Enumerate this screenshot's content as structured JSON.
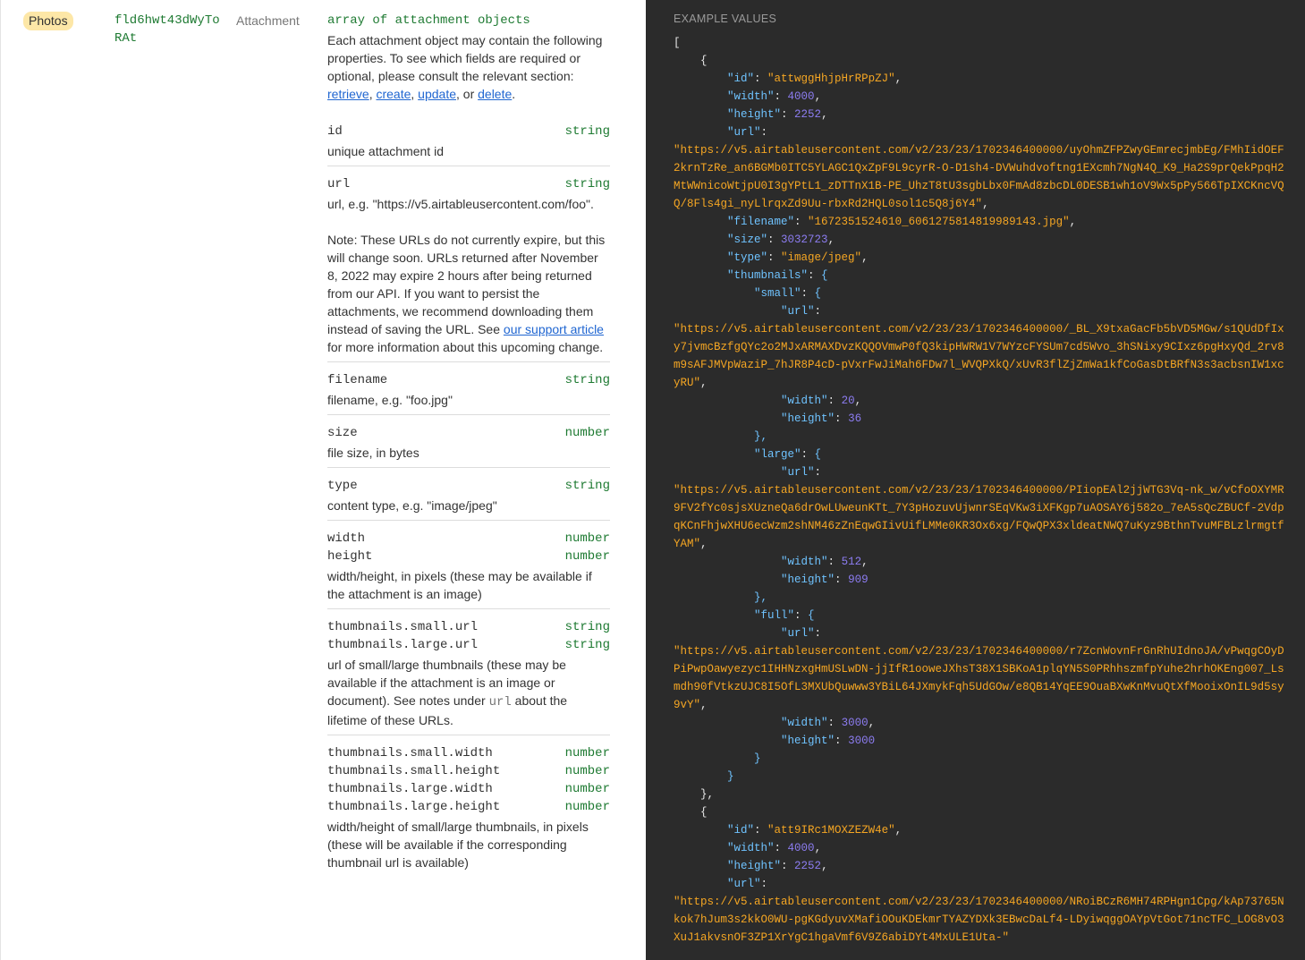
{
  "field": {
    "name": "Photos",
    "id": "fld6hwt43dWyToRAt",
    "type": "Attachment"
  },
  "description": {
    "type_label": "array of attachment objects",
    "intro_1": "Each attachment object may contain the following properties. To see which fields are required or optional, please consult the relevant section: ",
    "link_retrieve": "retrieve",
    "link_create": "create",
    "link_update": "update",
    "link_delete": "delete",
    "sep_1": ", ",
    "sep_2": ", ",
    "sep_3": ", or ",
    "end": ".",
    "properties": [
      {
        "name": "id",
        "kind": "string",
        "desc": "unique attachment id"
      },
      {
        "name": "url",
        "kind": "string",
        "desc": "url, e.g. \"https://v5.airtableusercontent.com/foo\"."
      },
      {
        "name": "filename",
        "kind": "string",
        "desc": "filename, e.g. \"foo.jpg\""
      },
      {
        "name": "size",
        "kind": "number",
        "desc": "file size, in bytes"
      },
      {
        "name": "type",
        "kind": "string",
        "desc": "content type, e.g. \"image/jpeg\""
      },
      {
        "name": "width",
        "kind": "number"
      },
      {
        "name": "height",
        "kind": "number",
        "desc": "width/height, in pixels (these may be available if the attachment is an image)"
      },
      {
        "name": "thumbnails.small.url",
        "kind": "string"
      },
      {
        "name": "thumbnails.large.url",
        "kind": "string",
        "desc_a": "url of small/large thumbnails (these may be available if the attachment is an image or document). See notes under ",
        "desc_code": "url",
        "desc_b": " about the lifetime of these URLs."
      },
      {
        "name": "thumbnails.small.width",
        "kind": "number"
      },
      {
        "name": "thumbnails.small.height",
        "kind": "number"
      },
      {
        "name": "thumbnails.large.width",
        "kind": "number"
      },
      {
        "name": "thumbnails.large.height",
        "kind": "number",
        "desc": "width/height of small/large thumbnails, in pixels (these will be available if the corresponding thumbnail url is available)"
      }
    ],
    "url_note_1": "Note: These URLs do not currently expire, but this will change soon. URLs returned after November 8, 2022 may expire 2 hours after being returned from our API. If you want to persist the attachments, we recommend downloading them instead of saving the URL. See ",
    "url_note_link": "our support article",
    "url_note_2": " for more information about this upcoming change."
  },
  "example": {
    "label": "EXAMPLE VALUES",
    "att1": {
      "id": "\"attwggHhjpHrRPpZJ\"",
      "width": "4000",
      "height": "2252",
      "url": "\"https://v5.airtableusercontent.com/v2/23/23/1702346400000/uyOhmZFPZwyGEmrecjmbEg/FMhIidOEF2krnTzRe_an6BGMb0ITC5YLAGC1QxZpF9L9cyrR-O-D1sh4-DVWuhdvoftng1EXcmh7NgN4Q_K9_Ha2S9prQekPpqH2MtWWnicoWtjpU0I3gYPtL1_zDTTnX1B-PE_UhzT8tU3sgbLbx0FmAd8zbcDL0DESB1wh1oV9Wx5pPy566TpIXCKncVQQ/8Fls4gi_nyLlrqxZd9Uu-rbxRd2HQL0sol1c5Q8j6Y4\"",
      "filename": "\"1672351524610_6061275814819989143.jpg\"",
      "size": "3032723",
      "type": "\"image/jpeg\"",
      "small_url": "\"https://v5.airtableusercontent.com/v2/23/23/1702346400000/_BL_X9txaGacFb5bVD5MGw/s1QUdDfIxy7jvmcBzfgQYc2o2MJxARMAXDvzKQQOVmwP0fQ3kipHWRW1V7WYzcFYSUm7cd5Wvo_3hSNixy9CIxz6pgHxyQd_2rv8m9sAFJMVpWaziP_7hJR8P4cD-pVxrFwJiMah6FDw7l_WVQPXkQ/xUvR3flZjZmWa1kfCoGasDtBRfN3s3acbsnIW1xcyRU\"",
      "small_width": "20",
      "small_height": "36",
      "large_url": "\"https://v5.airtableusercontent.com/v2/23/23/1702346400000/PIiopEAl2jjWTG3Vq-nk_w/vCfoOXYMR9FV2fYc0sjsXUzneQa6drOwLUweunKTt_7Y3pHozuvUjwnrSEqVKw3iXFKgp7uAOSAY6j582o_7eA5sQcZBUCf-2VdpqKCnFhjwXHU6ecWzm2shNM46zZnEqwGIivUifLMMe0KR3Ox6xg/FQwQPX3xldeatNWQ7uKyz9BthnTvuMFBLzlrmgtfYAM\"",
      "large_width": "512",
      "large_height": "909",
      "full_url": "\"https://v5.airtableusercontent.com/v2/23/23/1702346400000/r7ZcnWovnFrGnRhUIdnoJA/vPwqgCOyDPiPwpOawyezyc1IHHNzxgHmUSLwDN-jjIfR1ooweJXhsT38X1SBKoA1plqYN5S0PRhhszmfpYuhe2hrhOKEng007_Lsmdh90fVtkzUJC8I5OfL3MXUbQuwww3YBiL64JXmykFqh5UdGOw/e8QB14YqEE9OuaBXwKnMvuQtXfMooixOnIL9d5sy9vY\"",
      "full_width": "3000",
      "full_height": "3000"
    },
    "att2": {
      "id": "\"att9IRc1MOXZEZW4e\"",
      "width": "4000",
      "height": "2252",
      "url": "\"https://v5.airtableusercontent.com/v2/23/23/1702346400000/NRoiBCzR6MH74RPHgn1Cpg/kAp73765Nkok7hJum3s2kkO0WU-pgKGdyuvXMafiOOuKDEkmrTYAZYDXk3EBwcDaLf4-LDyiwqggOAYpVtGot71ncTFC_LOG8vO3XuJ1akvsnOF3ZP1XrYgC1hgaVmf6V9Z6abiDYt4MxULE1Uta-\""
    },
    "keys": {
      "id": "\"id\"",
      "width": "\"width\"",
      "height": "\"height\"",
      "url": "\"url\"",
      "filename": "\"filename\"",
      "size": "\"size\"",
      "type": "\"type\"",
      "thumbnails": "\"thumbnails\"",
      "small": "\"small\"",
      "large": "\"large\"",
      "full": "\"full\""
    }
  }
}
